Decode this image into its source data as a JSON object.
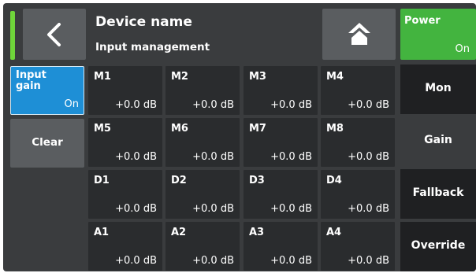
{
  "header": {
    "title": "Device name",
    "subtitle": "Input management",
    "back_icon": "chevron-left-icon",
    "home_icon": "home-icon",
    "power": {
      "label": "Power",
      "state": "On"
    }
  },
  "left": {
    "input_gain": {
      "label": "Input gain",
      "state": "On"
    },
    "clear_label": "Clear"
  },
  "grid": [
    {
      "name": "M1",
      "value": "+0.0 dB"
    },
    {
      "name": "M2",
      "value": "+0.0 dB"
    },
    {
      "name": "M3",
      "value": "+0.0 dB"
    },
    {
      "name": "M4",
      "value": "+0.0 dB"
    },
    {
      "name": "M5",
      "value": "+0.0 dB"
    },
    {
      "name": "M6",
      "value": "+0.0 dB"
    },
    {
      "name": "M7",
      "value": "+0.0 dB"
    },
    {
      "name": "M8",
      "value": "+0.0 dB"
    },
    {
      "name": "D1",
      "value": "+0.0 dB"
    },
    {
      "name": "D2",
      "value": "+0.0 dB"
    },
    {
      "name": "D3",
      "value": "+0.0 dB"
    },
    {
      "name": "D4",
      "value": "+0.0 dB"
    },
    {
      "name": "A1",
      "value": "+0.0 dB"
    },
    {
      "name": "A2",
      "value": "+0.0 dB"
    },
    {
      "name": "A3",
      "value": "+0.0 dB"
    },
    {
      "name": "A4",
      "value": "+0.0 dB"
    }
  ],
  "right_menu": [
    {
      "label": "Mon",
      "selected": false
    },
    {
      "label": "Gain",
      "selected": true
    },
    {
      "label": "Fallback",
      "selected": false
    },
    {
      "label": "Override",
      "selected": false
    }
  ],
  "colors": {
    "power_on": "#43b43f",
    "input_gain_active": "#1e8fd6",
    "status_indicator": "#6fd43a"
  }
}
